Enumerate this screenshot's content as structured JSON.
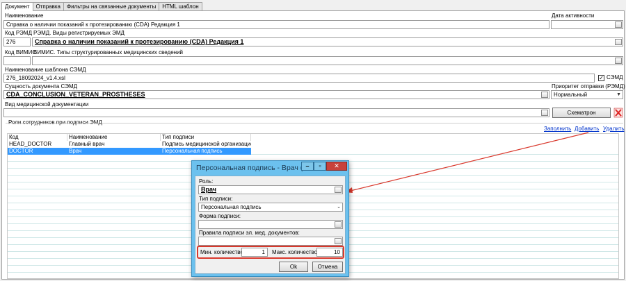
{
  "tabs": [
    "Документ",
    "Отправка",
    "Фильтры на связанные документы",
    "HTML шаблон"
  ],
  "form": {
    "name_label": "Наименование",
    "name_value": "Справка о наличии показаний к протезированию (CDA) Редакция 1",
    "activity_date_label": "Дата активности",
    "activity_date_value": "",
    "remd_code_label": "Код РЭМД",
    "remd_code_value": "276",
    "remd_types_label": "РЭМД. Виды регистрируемых ЭМД",
    "remd_types_value": "Справка о наличии показаний к протезированию (CDA) Редакция 1",
    "vimis_code_label": "Код ВИМИС",
    "vimis_code_value": "",
    "vimis_types_label": "ВИМИС. Типы структурированных медицинских сведений",
    "vimis_types_value": "",
    "template_label": "Наименование шаблона СЭМД",
    "template_value": "276_18092024_v1.4.xsl",
    "semd_checkbox_label": "СЭМД",
    "semd_checked": true,
    "entity_label": "Сущность документа СЭМД",
    "entity_value": "CDA_CONCLUSION_VETERAN_PROSTHESES",
    "priority_label": "Приоритет отправки (РЭМД)",
    "priority_value": "Нормальный",
    "med_doc_type_label": "Вид медицинской документации",
    "med_doc_type_value": "",
    "schematron_button": "Схематрон"
  },
  "roles": {
    "group_label": "Роли сотрудников при подписи ЭМД",
    "fill_link": "Заполнить",
    "add_link": "Добавить",
    "delete_link": "Удалить",
    "columns": [
      "Код",
      "Наименование",
      "Тип подписи"
    ],
    "rows": [
      {
        "code": "HEAD_DOCTOR",
        "name": "Главный врач",
        "sign_type": "Подпись медицинской организацией"
      },
      {
        "code": "DOCTOR",
        "name": "Врач",
        "sign_type": "Персональная подпись"
      }
    ]
  },
  "dialog": {
    "title": "Персональная подпись - Врач (С...",
    "role_label": "Роль:",
    "role_value": "Врач",
    "sign_type_label": "Тип подписи:",
    "sign_type_value": "Персональная подпись",
    "sign_form_label": "Форма подписи:",
    "sign_form_value": "",
    "rules_label": "Правила подписи эл. мед. документов:",
    "rules_value": "",
    "min_label": "Мин. количество:",
    "min_value": "1",
    "max_label": "Макс. количество:",
    "max_value": "10",
    "ok_button": "Ok",
    "cancel_button": "Отмена"
  },
  "colors": {
    "selection": "#3399ff",
    "dialog_frame": "#6cc1ee",
    "highlight": "#d9382c",
    "link": "#0033cc"
  }
}
